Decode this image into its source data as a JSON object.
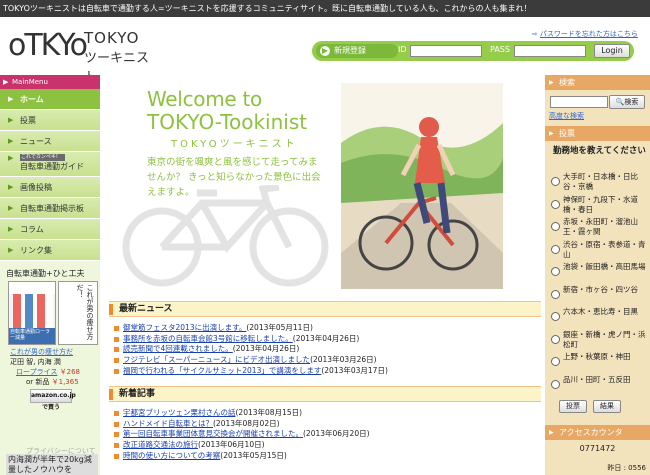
{
  "topbar": {
    "text": "TOKYOツーキニストは自転車で通勤する人=ツーキニストを応援するコミュニティサイト。既に自転車通勤している人も、これからの人も集まれ！"
  },
  "header": {
    "logo_mark": "oTKYo",
    "logo_en": "TOKYO",
    "logo_jp": "ツーキニスト",
    "forgot_link": "パスワードを忘れた方はこちら",
    "register_label": "新規登録",
    "id_label": "ID",
    "pass_label": "PASS",
    "login_button": "Login"
  },
  "leftnav": {
    "menu_head": "MainMenu",
    "items": [
      {
        "label": "ホーム",
        "active": true
      },
      {
        "label": "投票"
      },
      {
        "label": "ニュース"
      },
      {
        "tag": "これでカンペキ!",
        "label": "自転車通勤ガイド"
      },
      {
        "label": "画像投稿"
      },
      {
        "label": "自転車通勤掲示板"
      },
      {
        "label": "コラム"
      },
      {
        "label": "リンク集"
      }
    ],
    "book": {
      "section_title": "自転車通勤+ひと工夫",
      "spine_text": "これが男の痩せ方だ！",
      "cover_text": "自転車通勤ローラー減量",
      "title_link": "これが男の痩せ方だ",
      "author": "疋田 智, 内海 潤",
      "price_label": "ロープライス",
      "price": "￥268",
      "used_label": "or 新品",
      "used_price": "￥1,365",
      "amazon": "amazon.co.jp で買う"
    },
    "privacy": "プライバシーについて",
    "ad_text": "内海潤が半年で20kg減量したノウハウを"
  },
  "hero": {
    "welcome_line1": "Welcome to",
    "welcome_line2": "TOKYO-Tookinist",
    "welcome_jp": "TOKYOツーキニスト",
    "tagline": "東京の街を颯爽と風を感じて走ってみませんか？ きっと知らなかった景色に出会えますよ。"
  },
  "news": {
    "heading": "最新ニュース",
    "items": [
      {
        "title": "御堂筋フェスタ2013に出演します。",
        "date": "(2013年05月11日)"
      },
      {
        "title": "事務所を赤坂の自転車会館3号館に移転しました。",
        "date": "(2013年04月26日)"
      },
      {
        "title": "読売新聞で4回連載されました。",
        "date": "(2013年04月26日)"
      },
      {
        "title": "フジテレビ「スーパーニュース」にビデオ出演しました",
        "date": "(2013年03月26日)"
      },
      {
        "title": "福岡で行われる「サイクルサミット2013」で講演をします",
        "date": "(2013年03月17日)"
      }
    ]
  },
  "articles": {
    "heading": "新着記事",
    "items": [
      {
        "title": "宇都宮ブリッツェン栗村さんの話",
        "date": "(2013年08月15日)"
      },
      {
        "title": "ハンドメイド自転車とは？",
        "date": "(2013年08月02日)"
      },
      {
        "title": "第一回自転車事業団体意見交換会が開催されました。",
        "date": "(2013年06月20日)"
      },
      {
        "title": "改正道路交通法の施行",
        "date": "(2013年06月10日)"
      },
      {
        "title": "時間の使い方についての考察",
        "date": "(2013年05月15日)"
      }
    ]
  },
  "right": {
    "search_head": "検索",
    "search_button": "検索",
    "advanced_link": "高度な検索",
    "vote_head": "投票",
    "vote_question": "勤務地を教えてください",
    "vote_options": [
      "大手町・日本橋・日比谷・京橋",
      "神保町・九段下・水道橋・春日",
      "赤坂・永田町・溜池山王・霞ヶ関",
      "渋谷・原宿・表参道・青山",
      "池袋・飯田橋・高田馬場",
      "新宿・市ヶ谷・四ツ谷",
      "六本木・恵比寿・目黒",
      "銀座・新橋・虎ノ門・浜松町",
      "上野・秋葉原・神田",
      "品川・田町・五反田"
    ],
    "vote_button": "投票",
    "result_button": "結果",
    "access_head": "アクセスカウンタ",
    "access_count": "0771472",
    "yesterday": "昨日 : 0556"
  }
}
